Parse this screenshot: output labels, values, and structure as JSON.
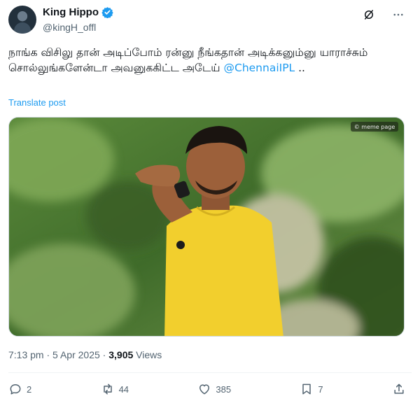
{
  "author": {
    "display_name": "King Hippo",
    "handle": "@kingH_offl"
  },
  "tweet": {
    "text_main": "நாங்க விசிலு தான் அடிப்போம் ரன்னு நீங்கதான் அடிக்கனும்னு யாராச்சும் சொல்லுங்களேன்டா அவனுககிட்ட அடேய் ",
    "mention": "@ChennaiIPL",
    "text_end": " ..",
    "translate_label": "Translate post",
    "media_watermark": "© meme page",
    "time": "7:13 pm",
    "date": "5 Apr 2025",
    "views_count": "3,905",
    "views_label": "Views"
  },
  "engagement": {
    "replies": "2",
    "reposts": "44",
    "likes": "385",
    "bookmarks": "7"
  },
  "icons": [
    "verified-badge-icon",
    "grok-icon",
    "more-icon",
    "reply-icon",
    "repost-icon",
    "like-icon",
    "bookmark-icon",
    "share-icon"
  ],
  "colors": {
    "accent": "#1d9bf0",
    "text": "#0f1419",
    "secondary": "#536471",
    "shirt": "#f2cf2d"
  }
}
